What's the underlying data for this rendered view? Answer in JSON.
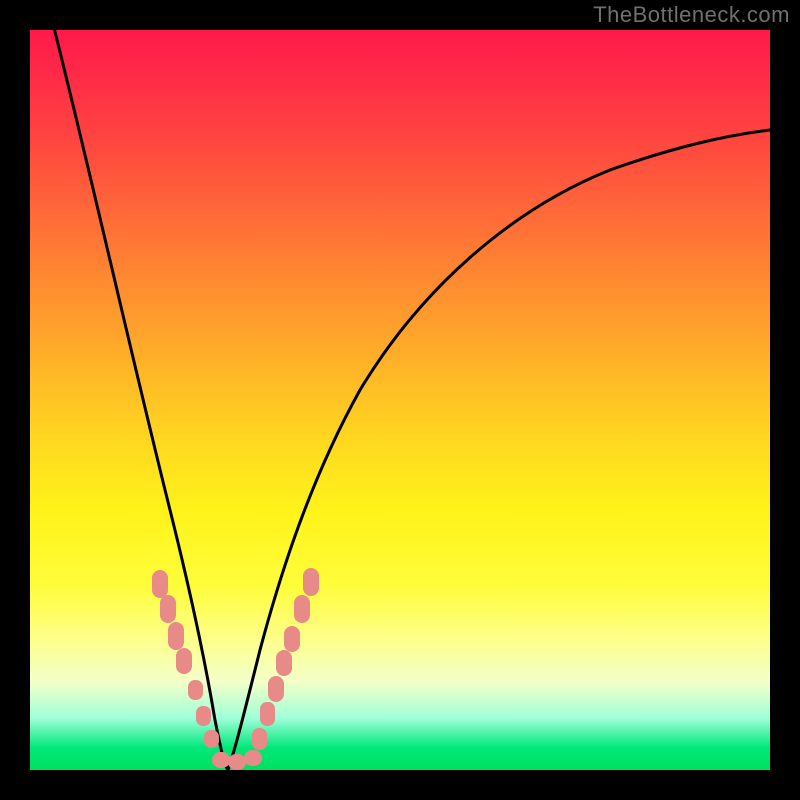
{
  "watermark": "TheBottleneck.com",
  "chart_data": {
    "type": "line",
    "title": "",
    "xlabel": "",
    "ylabel": "",
    "xlim": [
      0,
      100
    ],
    "ylim": [
      0,
      100
    ],
    "gradient_stops": [
      {
        "pos": 0,
        "color": "#ff1a4a"
      },
      {
        "pos": 25,
        "color": "#ff6a38"
      },
      {
        "pos": 55,
        "color": "#ffd620"
      },
      {
        "pos": 82,
        "color": "#fdff87"
      },
      {
        "pos": 97,
        "color": "#00e87a"
      },
      {
        "pos": 100,
        "color": "#00e060"
      }
    ],
    "series": [
      {
        "name": "bottleneck-curve-left",
        "x": [
          3,
          6,
          9,
          12,
          15,
          18,
          20,
          22,
          24,
          26
        ],
        "y": [
          100,
          80,
          62,
          46,
          32,
          20,
          12,
          6,
          2,
          0
        ]
      },
      {
        "name": "bottleneck-curve-right",
        "x": [
          26,
          28,
          30,
          33,
          37,
          42,
          50,
          60,
          72,
          85,
          100
        ],
        "y": [
          0,
          2,
          6,
          12,
          22,
          34,
          48,
          60,
          70,
          78,
          84
        ]
      }
    ],
    "markers": {
      "name": "highlight-points",
      "color": "#e88a87",
      "points": [
        {
          "x": 17,
          "y": 26
        },
        {
          "x": 18,
          "y": 22
        },
        {
          "x": 19,
          "y": 18
        },
        {
          "x": 20,
          "y": 14
        },
        {
          "x": 22,
          "y": 9
        },
        {
          "x": 23,
          "y": 6
        },
        {
          "x": 24,
          "y": 4
        },
        {
          "x": 25,
          "y": 1
        },
        {
          "x": 26,
          "y": 0
        },
        {
          "x": 27,
          "y": 0
        },
        {
          "x": 28,
          "y": 0
        },
        {
          "x": 29,
          "y": 3
        },
        {
          "x": 30,
          "y": 5
        },
        {
          "x": 31,
          "y": 9
        },
        {
          "x": 32,
          "y": 11
        },
        {
          "x": 33,
          "y": 14
        },
        {
          "x": 35,
          "y": 20
        },
        {
          "x": 36,
          "y": 23
        },
        {
          "x": 37,
          "y": 26
        }
      ]
    }
  }
}
